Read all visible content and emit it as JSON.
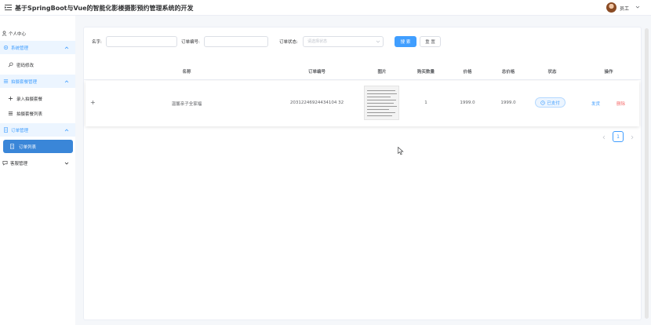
{
  "header": {
    "title": "基于SpringBoot与Vue的智能化影楼摄影预约管理系统的开发",
    "user_name": "员工",
    "menu_icon": "menu-fold-icon",
    "caret_icon": "chevron-down-icon"
  },
  "sidebar": {
    "items": [
      {
        "label": "个人中心",
        "icon": "user-icon"
      },
      {
        "label": "系统管理",
        "icon": "gear-icon"
      },
      {
        "label": "密码修改",
        "icon": "key-icon"
      },
      {
        "label": "拍摄套餐管理",
        "icon": "list-icon"
      },
      {
        "label": "录入拍摄套餐",
        "icon": "plus-icon"
      },
      {
        "label": "拍摄套餐列表",
        "icon": "list-icon"
      },
      {
        "label": "订单管理",
        "icon": "document-icon"
      },
      {
        "label": "订单列表",
        "icon": "document-icon"
      },
      {
        "label": "客服管理",
        "icon": "chat-icon"
      }
    ]
  },
  "filters": {
    "name_label": "名字:",
    "name_value": "",
    "order_no_label": "订单编号:",
    "order_no_value": "",
    "status_label": "订单状态:",
    "status_placeholder": "请选择状态",
    "search_button": "搜 索",
    "reset_button": "重 置"
  },
  "table": {
    "columns": [
      "名称",
      "订单编号",
      "图片",
      "购买数量",
      "价格",
      "总价格",
      "状态",
      "操作"
    ],
    "rows": [
      {
        "expand": "+",
        "name": "温馨亲子全家福",
        "order_no": "20312246924434104 32",
        "quantity": "1",
        "price": "1999.0",
        "total": "1999.0",
        "status": "已支付",
        "action_ship": "发货",
        "action_delete": "删除"
      }
    ]
  },
  "pagination": {
    "current_page": "1"
  },
  "colors": {
    "primary": "#409eff",
    "danger": "#f56c6c",
    "active_menu": "#3a86d8"
  }
}
